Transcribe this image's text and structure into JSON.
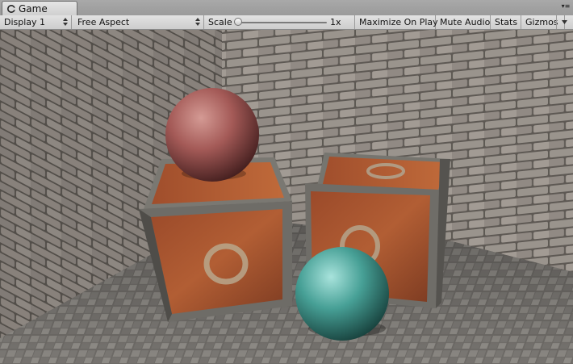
{
  "tab": {
    "label": "Game",
    "icon": "game-controller-icon"
  },
  "toolbar": {
    "display": "Display 1",
    "aspect": "Free Aspect",
    "scale_label": "Scale",
    "scale_value": "1x",
    "scale_level": 0.0,
    "maximize": "Maximize On Play",
    "mute": "Mute Audio",
    "stats": "Stats",
    "gizmos": "Gizmos"
  },
  "colors": {
    "tab_bg": "#dcdcdc",
    "toolbar_bg": "#d6d6d6",
    "brick": "#8c8580",
    "crate_rust": "#a4532e",
    "sphere_red": "#a85555",
    "sphere_teal": "#4aa29a",
    "floor": "#7e7c78"
  }
}
